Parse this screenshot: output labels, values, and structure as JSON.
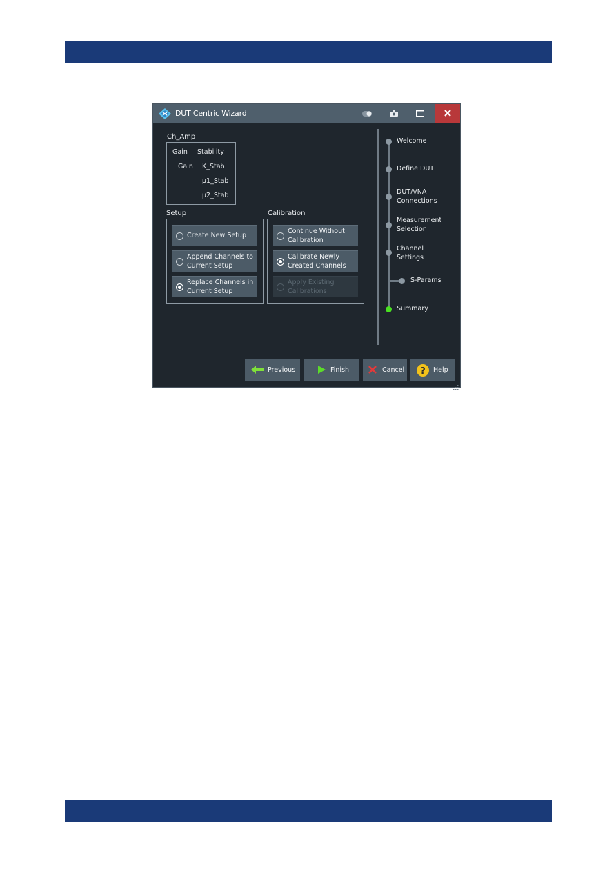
{
  "window": {
    "title": "DUT Centric Wizard",
    "controls": [
      "toggle",
      "screenshot",
      "maximize",
      "close"
    ]
  },
  "channel": {
    "name": "Ch_Amp",
    "headers": [
      "Gain",
      "Stability"
    ],
    "gain_items": [
      "Gain"
    ],
    "stability_items": [
      "K_Stab",
      "μ1_Stab",
      "μ2_Stab"
    ]
  },
  "setup": {
    "label": "Setup",
    "options": [
      {
        "line1": "Create New Setup",
        "line2": "",
        "selected": false,
        "enabled": true
      },
      {
        "line1": "Append Channels to",
        "line2": "Current Setup",
        "selected": false,
        "enabled": true
      },
      {
        "line1": "Replace Channels in",
        "line2": "Current Setup",
        "selected": true,
        "enabled": true
      }
    ]
  },
  "calibration": {
    "label": "Calibration",
    "options": [
      {
        "line1": "Continue Without",
        "line2": "Calibration",
        "selected": false,
        "enabled": true
      },
      {
        "line1": "Calibrate Newly",
        "line2": "Created Channels",
        "selected": true,
        "enabled": true
      },
      {
        "line1": "Apply Existing",
        "line2": "Calibrations",
        "selected": false,
        "enabled": false
      }
    ]
  },
  "steps": [
    {
      "line1": "Welcome",
      "line2": "",
      "active": false
    },
    {
      "line1": "Define DUT",
      "line2": "",
      "active": false
    },
    {
      "line1": "DUT/VNA",
      "line2": "Connections",
      "active": false
    },
    {
      "line1": "Measurement",
      "line2": "Selection",
      "active": false
    },
    {
      "line1": "Channel",
      "line2": "Settings",
      "active": false
    },
    {
      "line1": "S-Params",
      "line2": "",
      "active": false,
      "substep": true
    },
    {
      "line1": "Summary",
      "line2": "",
      "active": true
    }
  ],
  "buttons": {
    "previous": "Previous",
    "finish": "Finish",
    "cancel": "Cancel",
    "help": "Help"
  },
  "colors": {
    "page_band": "#1a3a78",
    "window_bg": "#1f262d",
    "titlebar": "#4f5f6c",
    "close": "#b8383a",
    "button": "#4c5b67",
    "active_step": "#49e021",
    "arrow_green": "#7fe03a",
    "cancel_red": "#e23a3a",
    "help_yellow": "#f2c21b"
  }
}
